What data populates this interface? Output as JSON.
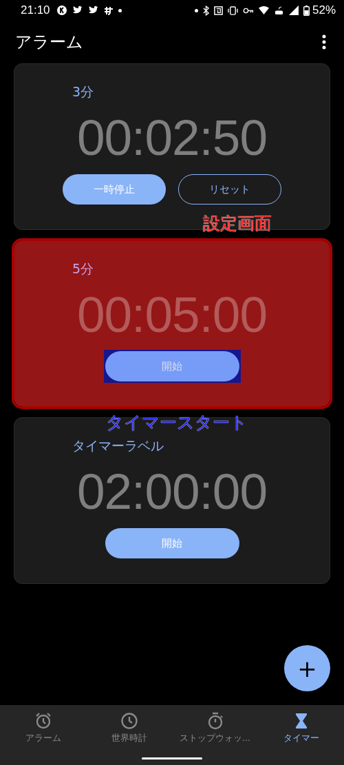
{
  "status_bar": {
    "time": "21:10",
    "battery": "52%"
  },
  "app_bar": {
    "title": "アラーム"
  },
  "timers": [
    {
      "label": "3分",
      "time": "00:02:50",
      "highlighted": false,
      "buttons": [
        {
          "label": "一時停止",
          "kind": "filled",
          "framed": false
        },
        {
          "label": "リセット",
          "kind": "outlined",
          "framed": false
        }
      ],
      "annotation": {
        "text": "設定画面",
        "color": "#ff1a1a"
      }
    },
    {
      "label": "5分",
      "time": "00:05:00",
      "highlighted": true,
      "buttons": [
        {
          "label": "開始",
          "kind": "filled",
          "framed": true
        }
      ],
      "annotation": {
        "text": "タイマースタート",
        "color": "#1a1aff"
      }
    },
    {
      "label": "タイマーラベル",
      "time": "02:00:00",
      "highlighted": false,
      "buttons": [
        {
          "label": "開始",
          "kind": "filled",
          "framed": false
        }
      ]
    }
  ],
  "fab": {
    "label": "+"
  },
  "bottom_nav": [
    {
      "label": "アラーム",
      "kind": "alarm",
      "selected": false
    },
    {
      "label": "世界時計",
      "kind": "clock",
      "selected": false
    },
    {
      "label": "ストップウォッ...",
      "kind": "stopwatch",
      "selected": false
    },
    {
      "label": "タイマー",
      "kind": "timer",
      "selected": true
    }
  ]
}
